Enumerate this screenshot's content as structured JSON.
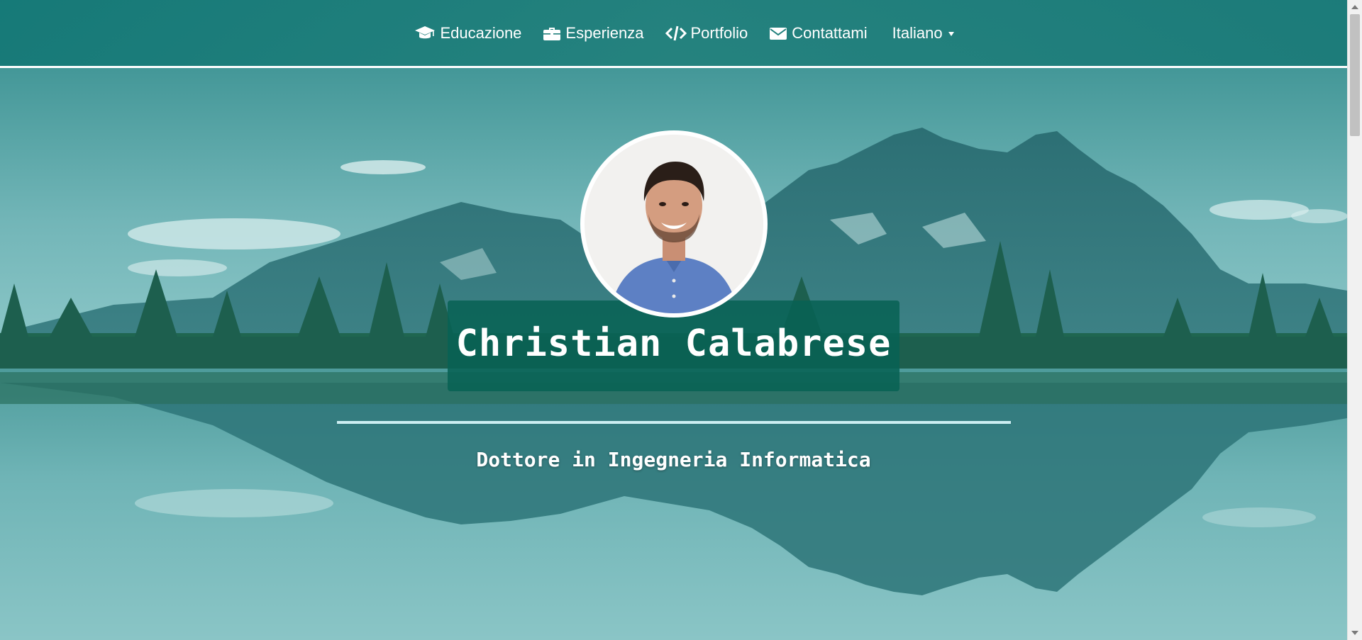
{
  "nav": {
    "items": [
      {
        "label": "Educazione",
        "icon": "graduation-cap-icon"
      },
      {
        "label": "Esperienza",
        "icon": "briefcase-icon"
      },
      {
        "label": "Portfolio",
        "icon": "code-icon"
      },
      {
        "label": "Contattami",
        "icon": "envelope-icon"
      }
    ],
    "language": "Italiano"
  },
  "hero": {
    "name": "Christian Calabrese",
    "subtitle": "Dottore in Ingegneria Informatica"
  },
  "colors": {
    "nav_bg": "#1f7f7b",
    "name_box_bg": "#08624f",
    "divider": "#cdeef2",
    "text": "#ffffff"
  }
}
